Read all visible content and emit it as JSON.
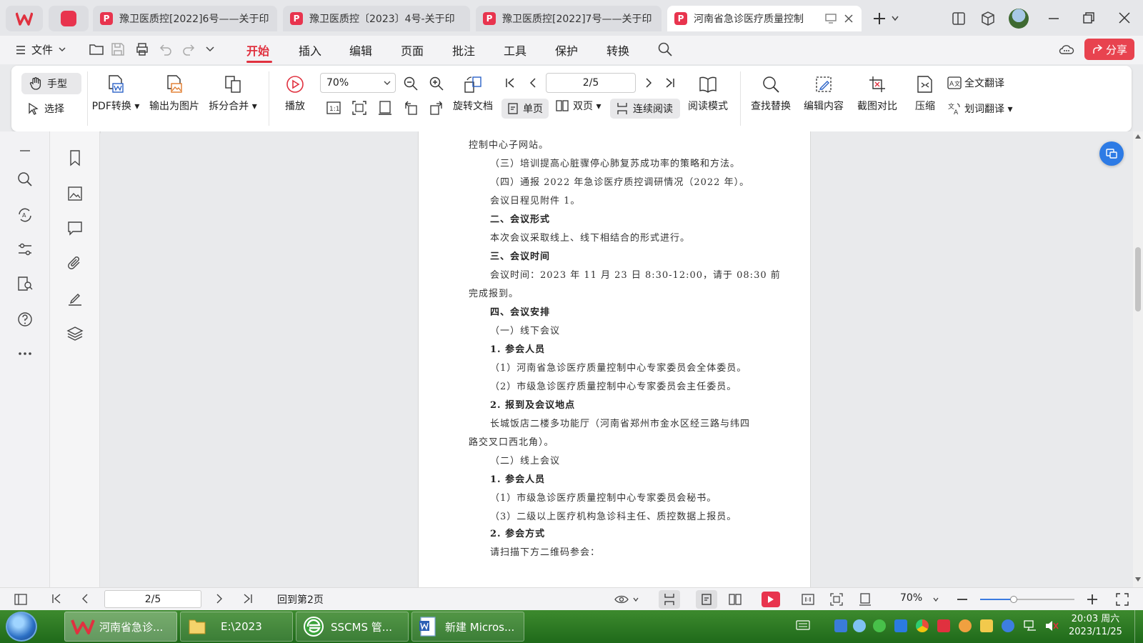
{
  "tabs": [
    {
      "label": "豫卫医质控[2022]6号——关于印"
    },
    {
      "label": "豫卫医质控〔2023〕4号-关于印"
    },
    {
      "label": "豫卫医质控[2022]7号——关于印"
    },
    {
      "label": "河南省急诊医疗质量控制"
    }
  ],
  "menu": {
    "file": "文件",
    "items": [
      "开始",
      "插入",
      "编辑",
      "页面",
      "批注",
      "工具",
      "保护",
      "转换"
    ],
    "share": "分享"
  },
  "ribbon": {
    "hand": "手型",
    "select": "选择",
    "pdf_convert": "PDF转换",
    "export_image": "输出为图片",
    "split_merge": "拆分合并",
    "play": "播放",
    "zoom": "70%",
    "page_box": "2/5",
    "rotate_doc": "旋转文档",
    "single_page": "单页",
    "double_page": "双页",
    "continuous": "连续阅读",
    "read_mode": "阅读模式",
    "find_replace": "查找替换",
    "edit_content": "编辑内容",
    "screenshot_compare": "截图对比",
    "compress": "压缩",
    "full_translate": "全文翻译",
    "word_translate": "划词翻译"
  },
  "document": {
    "lines": [
      "控制中心子网站。",
      "（三）培训提高心脏骤停心肺复苏成功率的策略和方法。",
      "（四）通报 2022 年急诊医疗质控调研情况（2022 年）。",
      "会议日程见附件 1。",
      "二、会议形式",
      "本次会议采取线上、线下相结合的形式进行。",
      "三、会议时间",
      "会议时间：2023 年 11 月 23 日 8:30-12:00，请于 08:30 前",
      "完成报到。",
      "四、会议安排",
      "（一）线下会议",
      "1. 参会人员",
      "（1）河南省急诊医疗质量控制中心专家委员会全体委员。",
      "（2）市级急诊医疗质量控制中心专家委员会主任委员。",
      "2. 报到及会议地点",
      "长城饭店二楼多功能厅（河南省郑州市金水区经三路与纬四",
      "路交叉口西北角）。",
      "（二）线上会议",
      "1. 参会人员",
      "（1）市级急诊医疗质量控制中心专家委员会秘书。",
      "（3）二级以上医疗机构急诊科主任、质控数据上报员。",
      "2. 参会方式",
      "请扫描下方二维码参会："
    ]
  },
  "status": {
    "page": "2/5",
    "goto": "回到第2页",
    "zoom": "70%"
  },
  "taskbar": {
    "items": [
      "河南省急诊...",
      "E:\\2023",
      "SSCMS 管...",
      "新建 Micros..."
    ],
    "time": "20:03 周六",
    "date": "2023/11/25"
  },
  "colors": {
    "accent": "#e0313f",
    "taskbar": "#2e7a24"
  }
}
